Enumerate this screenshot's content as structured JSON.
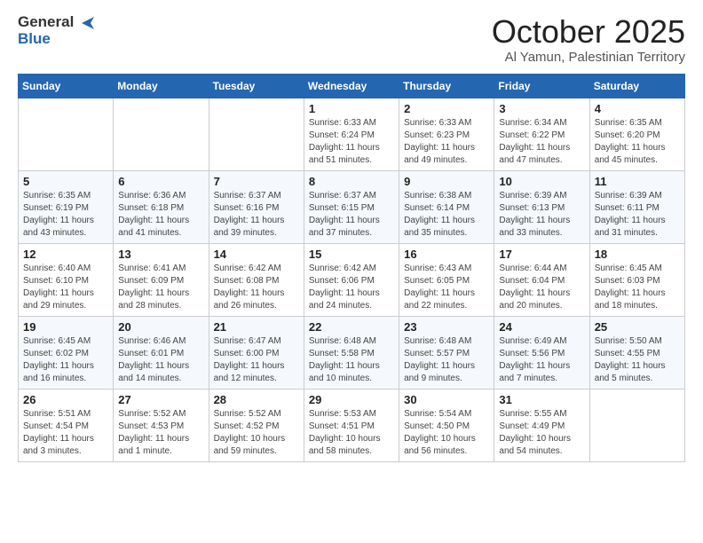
{
  "header": {
    "logo_general": "General",
    "logo_blue": "Blue",
    "month": "October 2025",
    "location": "Al Yamun, Palestinian Territory"
  },
  "days_of_week": [
    "Sunday",
    "Monday",
    "Tuesday",
    "Wednesday",
    "Thursday",
    "Friday",
    "Saturday"
  ],
  "weeks": [
    [
      {
        "day": "",
        "info": ""
      },
      {
        "day": "",
        "info": ""
      },
      {
        "day": "",
        "info": ""
      },
      {
        "day": "1",
        "info": "Sunrise: 6:33 AM\nSunset: 6:24 PM\nDaylight: 11 hours\nand 51 minutes."
      },
      {
        "day": "2",
        "info": "Sunrise: 6:33 AM\nSunset: 6:23 PM\nDaylight: 11 hours\nand 49 minutes."
      },
      {
        "day": "3",
        "info": "Sunrise: 6:34 AM\nSunset: 6:22 PM\nDaylight: 11 hours\nand 47 minutes."
      },
      {
        "day": "4",
        "info": "Sunrise: 6:35 AM\nSunset: 6:20 PM\nDaylight: 11 hours\nand 45 minutes."
      }
    ],
    [
      {
        "day": "5",
        "info": "Sunrise: 6:35 AM\nSunset: 6:19 PM\nDaylight: 11 hours\nand 43 minutes."
      },
      {
        "day": "6",
        "info": "Sunrise: 6:36 AM\nSunset: 6:18 PM\nDaylight: 11 hours\nand 41 minutes."
      },
      {
        "day": "7",
        "info": "Sunrise: 6:37 AM\nSunset: 6:16 PM\nDaylight: 11 hours\nand 39 minutes."
      },
      {
        "day": "8",
        "info": "Sunrise: 6:37 AM\nSunset: 6:15 PM\nDaylight: 11 hours\nand 37 minutes."
      },
      {
        "day": "9",
        "info": "Sunrise: 6:38 AM\nSunset: 6:14 PM\nDaylight: 11 hours\nand 35 minutes."
      },
      {
        "day": "10",
        "info": "Sunrise: 6:39 AM\nSunset: 6:13 PM\nDaylight: 11 hours\nand 33 minutes."
      },
      {
        "day": "11",
        "info": "Sunrise: 6:39 AM\nSunset: 6:11 PM\nDaylight: 11 hours\nand 31 minutes."
      }
    ],
    [
      {
        "day": "12",
        "info": "Sunrise: 6:40 AM\nSunset: 6:10 PM\nDaylight: 11 hours\nand 29 minutes."
      },
      {
        "day": "13",
        "info": "Sunrise: 6:41 AM\nSunset: 6:09 PM\nDaylight: 11 hours\nand 28 minutes."
      },
      {
        "day": "14",
        "info": "Sunrise: 6:42 AM\nSunset: 6:08 PM\nDaylight: 11 hours\nand 26 minutes."
      },
      {
        "day": "15",
        "info": "Sunrise: 6:42 AM\nSunset: 6:06 PM\nDaylight: 11 hours\nand 24 minutes."
      },
      {
        "day": "16",
        "info": "Sunrise: 6:43 AM\nSunset: 6:05 PM\nDaylight: 11 hours\nand 22 minutes."
      },
      {
        "day": "17",
        "info": "Sunrise: 6:44 AM\nSunset: 6:04 PM\nDaylight: 11 hours\nand 20 minutes."
      },
      {
        "day": "18",
        "info": "Sunrise: 6:45 AM\nSunset: 6:03 PM\nDaylight: 11 hours\nand 18 minutes."
      }
    ],
    [
      {
        "day": "19",
        "info": "Sunrise: 6:45 AM\nSunset: 6:02 PM\nDaylight: 11 hours\nand 16 minutes."
      },
      {
        "day": "20",
        "info": "Sunrise: 6:46 AM\nSunset: 6:01 PM\nDaylight: 11 hours\nand 14 minutes."
      },
      {
        "day": "21",
        "info": "Sunrise: 6:47 AM\nSunset: 6:00 PM\nDaylight: 11 hours\nand 12 minutes."
      },
      {
        "day": "22",
        "info": "Sunrise: 6:48 AM\nSunset: 5:58 PM\nDaylight: 11 hours\nand 10 minutes."
      },
      {
        "day": "23",
        "info": "Sunrise: 6:48 AM\nSunset: 5:57 PM\nDaylight: 11 hours\nand 9 minutes."
      },
      {
        "day": "24",
        "info": "Sunrise: 6:49 AM\nSunset: 5:56 PM\nDaylight: 11 hours\nand 7 minutes."
      },
      {
        "day": "25",
        "info": "Sunrise: 5:50 AM\nSunset: 4:55 PM\nDaylight: 11 hours\nand 5 minutes."
      }
    ],
    [
      {
        "day": "26",
        "info": "Sunrise: 5:51 AM\nSunset: 4:54 PM\nDaylight: 11 hours\nand 3 minutes."
      },
      {
        "day": "27",
        "info": "Sunrise: 5:52 AM\nSunset: 4:53 PM\nDaylight: 11 hours\nand 1 minute."
      },
      {
        "day": "28",
        "info": "Sunrise: 5:52 AM\nSunset: 4:52 PM\nDaylight: 10 hours\nand 59 minutes."
      },
      {
        "day": "29",
        "info": "Sunrise: 5:53 AM\nSunset: 4:51 PM\nDaylight: 10 hours\nand 58 minutes."
      },
      {
        "day": "30",
        "info": "Sunrise: 5:54 AM\nSunset: 4:50 PM\nDaylight: 10 hours\nand 56 minutes."
      },
      {
        "day": "31",
        "info": "Sunrise: 5:55 AM\nSunset: 4:49 PM\nDaylight: 10 hours\nand 54 minutes."
      },
      {
        "day": "",
        "info": ""
      }
    ]
  ]
}
